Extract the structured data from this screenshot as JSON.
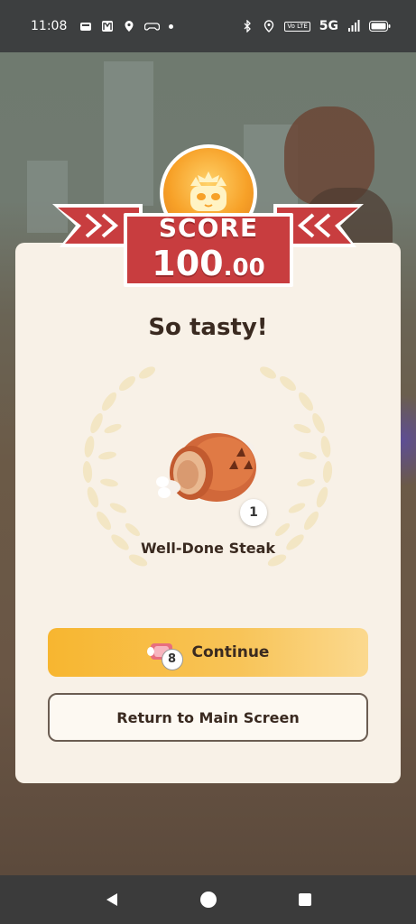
{
  "status_bar": {
    "time": "11:08",
    "left_icons": [
      "wallet-icon",
      "m-app-icon",
      "location-icon",
      "gamepad-icon",
      "dot-icon"
    ],
    "right_icons": [
      "bluetooth-icon",
      "location-icon",
      "volte-icon",
      "5g-icon",
      "signal-icon",
      "battery-icon"
    ],
    "volte_text": "Vo LTE",
    "network": "5G"
  },
  "score": {
    "label": "SCORE",
    "value_int": "100",
    "value_dec": ".00"
  },
  "result": {
    "title": "So tasty!",
    "item_name": "Well-Done Steak",
    "item_count": "1",
    "item_icon": "steak-icon"
  },
  "buttons": {
    "continue_label": "Continue",
    "continue_cost": "8",
    "continue_icon": "meat-ticket-icon",
    "return_label": "Return to Main Screen"
  },
  "nav": {
    "back_icon": "back-triangle-icon",
    "home_icon": "home-circle-icon",
    "recents_icon": "recents-square-icon"
  },
  "colors": {
    "card_bg": "#f8f1e7",
    "score_red": "#c83d3f",
    "continue_gold": "#f7b630",
    "text_dark": "#3a2a20"
  }
}
